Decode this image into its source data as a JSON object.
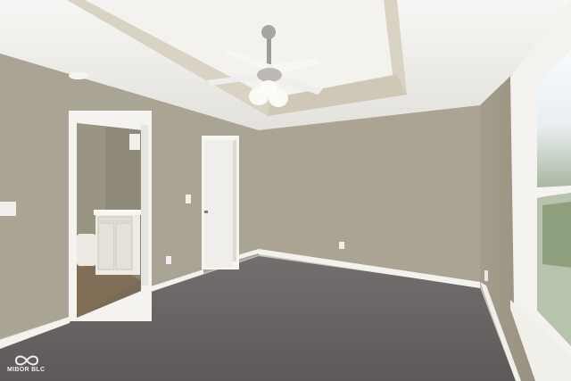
{
  "scene": {
    "description_name": "empty-bedroom-photo",
    "colors": {
      "wall_left": "#a9a393",
      "wall_back": "#aba391",
      "wall_right": "#9f9887",
      "ceiling": "#f1f0ed",
      "tray": "#d8d2c2",
      "carpet": "#6b6464",
      "trim": "#f4f3f0",
      "bath_floor": "#7b6a55",
      "vanity": "#eeede6"
    }
  },
  "watermark": {
    "logo_icon": "mibor-infinity-logo",
    "text": "MIBOR BLC"
  }
}
